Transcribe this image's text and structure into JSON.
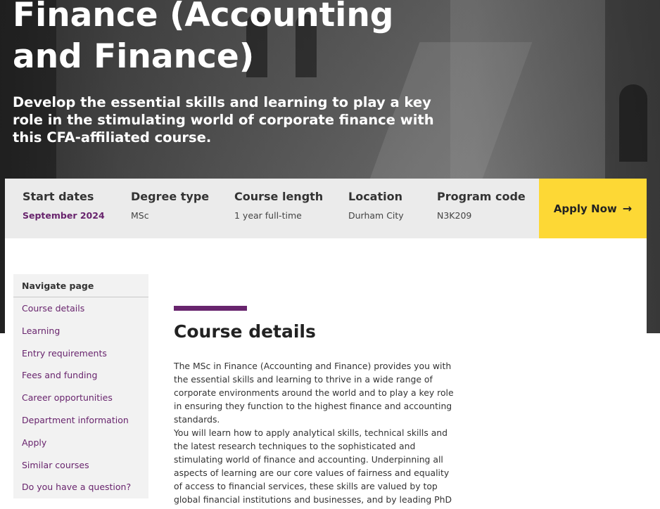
{
  "hero": {
    "title": "Finance (Accounting and Finance)",
    "subtitle": "Develop the essential skills and learning to play a key role in the stimulating world of corporate finance with this CFA-affiliated course."
  },
  "infobar": {
    "items": [
      {
        "label": "Start dates",
        "value": "September 2024"
      },
      {
        "label": "Degree type",
        "value": "MSc"
      },
      {
        "label": "Course length",
        "value": "1 year full-time"
      },
      {
        "label": "Location",
        "value": "Durham City"
      },
      {
        "label": "Program code",
        "value": "N3K209"
      }
    ],
    "apply_label": "Apply Now",
    "apply_arrow": "→"
  },
  "sidenav": {
    "heading": "Navigate page",
    "items": [
      "Course details",
      "Learning",
      "Entry requirements",
      "Fees and funding",
      "Career opportunities",
      "Department information",
      "Apply",
      "Similar courses",
      "Do you have a question?"
    ]
  },
  "main": {
    "section_title": "Course details",
    "paragraphs": [
      "The MSc in Finance (Accounting and Finance) provides you with the essential skills and learning to thrive in a wide range of corporate environments around the world and to play a key role in ensuring they function to the highest finance and accounting standards.",
      "You will learn how to apply analytical skills, technical skills and the latest research techniques to the sophisticated and stimulating world of finance and accounting. Underpinning all aspects of learning are our core values of fairness and equality of access to financial services, these skills are valued by top global financial institutions and businesses, and by leading PhD research"
    ]
  },
  "colors": {
    "accent_purple": "#68246d",
    "apply_yellow": "#fdd835",
    "infobar_bg": "#ebebeb",
    "sidenav_bg": "#f2f2f2"
  }
}
